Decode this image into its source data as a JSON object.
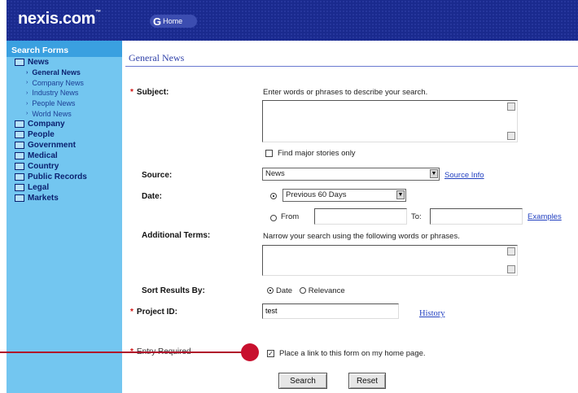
{
  "header": {
    "logo": "nexis.com",
    "logo_mark": "™",
    "home_label": "Home",
    "home_glyph": "G"
  },
  "sidebar": {
    "title": "Search Forms",
    "groups": [
      {
        "label": "News",
        "subs": [
          "General News",
          "Company News",
          "Industry News",
          "People News",
          "World News"
        ]
      },
      {
        "label": "Company"
      },
      {
        "label": "People"
      },
      {
        "label": "Government"
      },
      {
        "label": "Medical"
      },
      {
        "label": "Country"
      },
      {
        "label": "Public Records"
      },
      {
        "label": "Legal"
      },
      {
        "label": "Markets"
      }
    ],
    "active_sub": "General News"
  },
  "form": {
    "title": "General News",
    "subject_label": "Subject:",
    "subject_hint": "Enter words or phrases to describe your search.",
    "major_stories_label": "Find major stories only",
    "source_label": "Source:",
    "source_value": "News",
    "source_info_link": "Source Info",
    "date_label": "Date:",
    "date_preset": "Previous 60 Days",
    "from_label": "From",
    "to_label": "To:",
    "examples_link": "Examples",
    "additional_label": "Additional Terms:",
    "additional_hint": "Narrow your search using the following words or phrases.",
    "sort_label": "Sort Results By:",
    "sort_date": "Date",
    "sort_relevance": "Relevance",
    "project_label": "Project ID:",
    "project_value": "test",
    "history_link": "History",
    "entry_required": "Entry Required",
    "home_link_text": "Place a link to this form on my home page.",
    "search_button": "Search",
    "reset_button": "Reset",
    "required_mark": "*"
  }
}
